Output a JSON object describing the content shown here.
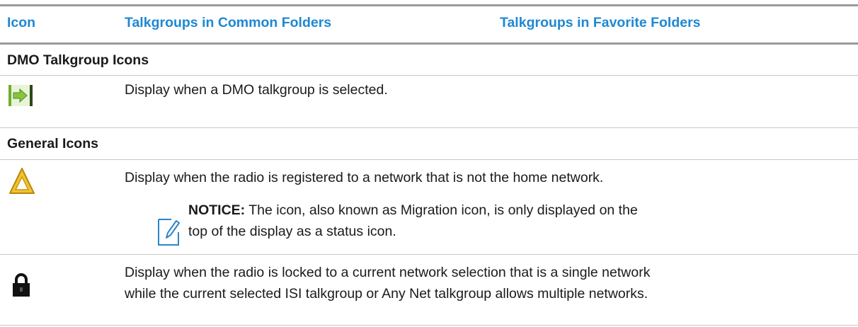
{
  "table": {
    "headers": {
      "icon": "Icon",
      "common": "Talkgroups in Common Folders",
      "favorite": "Talkgroups in Favorite Folders"
    },
    "sections": [
      {
        "title": "DMO Talkgroup Icons",
        "rows": [
          {
            "icon": "dmo-talkgroup-icon",
            "text": "Display when a DMO talkgroup is selected."
          }
        ]
      },
      {
        "title": "General Icons",
        "rows": [
          {
            "icon": "migration-triangle-icon",
            "text": "Display when the radio is registered to a network that is not the home network.",
            "notice": {
              "label": "NOTICE:",
              "line1": " The icon, also known as Migration icon, is only displayed on the",
              "line2": "top of the display as a status icon."
            }
          },
          {
            "icon": "padlock-icon",
            "line1": "Display when the radio is locked to a current network selection that is a single network",
            "line2": "while the current selected ISI talkgroup or Any Net talkgroup allows multiple networks."
          }
        ]
      }
    ]
  },
  "colors": {
    "header_text": "#1e88d2",
    "rule": "#9a9a9a",
    "icon_green": "#8ac43f",
    "icon_yellow": "#f2c230",
    "notice_blue": "#2b86c8"
  }
}
